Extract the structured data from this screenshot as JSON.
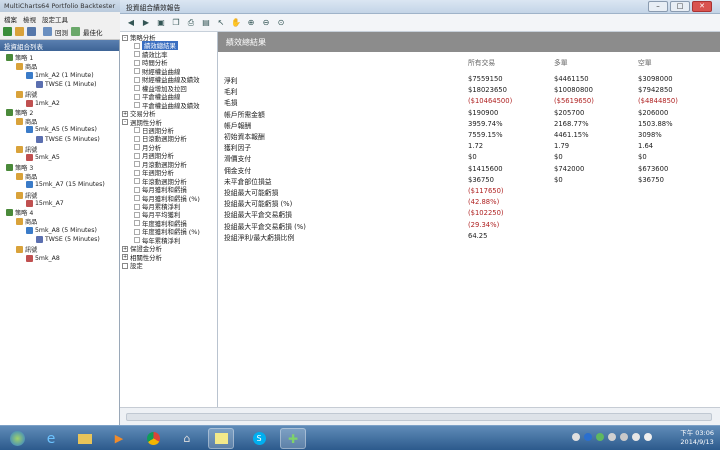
{
  "app": {
    "title": "MultiCharts64 Portfolio Backtester",
    "menu": [
      "檔案",
      "檢視",
      "設定工具"
    ],
    "toolbar": {
      "left_btn": "回測",
      "right_btn": "最佳化"
    }
  },
  "left_panel": {
    "header": "投資組合列表",
    "nodes": [
      {
        "label": "策略 1",
        "type": "strategy"
      },
      {
        "label": "商品",
        "type": "folder"
      },
      {
        "label": "1mk_A2 (1 Minute)",
        "type": "instrument"
      },
      {
        "label": "TWSE (1 Minute)",
        "type": "data"
      },
      {
        "label": "訊號",
        "type": "folder"
      },
      {
        "label": "1mk_A2",
        "type": "signal"
      },
      {
        "label": "策略 2",
        "type": "strategy"
      },
      {
        "label": "商品",
        "type": "folder"
      },
      {
        "label": "5mk_A5 (5 Minutes)",
        "type": "instrument"
      },
      {
        "label": "TWSE (5 Minutes)",
        "type": "data"
      },
      {
        "label": "訊號",
        "type": "folder"
      },
      {
        "label": "5mk_A5",
        "type": "signal"
      },
      {
        "label": "策略 3",
        "type": "strategy"
      },
      {
        "label": "商品",
        "type": "folder"
      },
      {
        "label": "15mk_A7 (15 Minutes)",
        "type": "instrument"
      },
      {
        "label": "訊號",
        "type": "folder"
      },
      {
        "label": "15mk_A7",
        "type": "signal"
      },
      {
        "label": "策略 4",
        "type": "strategy"
      },
      {
        "label": "商品",
        "type": "folder"
      },
      {
        "label": "5mk_A8 (5 Minutes)",
        "type": "instrument"
      },
      {
        "label": "TWSE (5 Minutes)",
        "type": "data"
      },
      {
        "label": "訊號",
        "type": "folder"
      },
      {
        "label": "5mk_A8",
        "type": "signal"
      }
    ]
  },
  "window": {
    "title": "投資組合績效報告",
    "min": "–",
    "max": "□",
    "close": "✕"
  },
  "nav": {
    "items": [
      {
        "label": "策略分析",
        "level": 0,
        "box": "-"
      },
      {
        "label": "績效總結果",
        "level": 1,
        "selected": true
      },
      {
        "label": "績效比率",
        "level": 1
      },
      {
        "label": "時間分析",
        "level": 1
      },
      {
        "label": "財經權益曲線",
        "level": 1
      },
      {
        "label": "財經權益曲線及績效",
        "level": 1
      },
      {
        "label": "權益增加及拉回",
        "level": 1
      },
      {
        "label": "平倉權益曲線",
        "level": 1
      },
      {
        "label": "平倉權益曲線及績效",
        "level": 1
      },
      {
        "label": "交易分析",
        "level": 0,
        "box": "+"
      },
      {
        "label": "週期性分析",
        "level": 0,
        "box": "-"
      },
      {
        "label": "日週期分析",
        "level": 1
      },
      {
        "label": "日滾動週期分析",
        "level": 1
      },
      {
        "label": "月分析",
        "level": 1
      },
      {
        "label": "月週期分析",
        "level": 1
      },
      {
        "label": "月滾動週期分析",
        "level": 1
      },
      {
        "label": "年週期分析",
        "level": 1
      },
      {
        "label": "年滾動週期分析",
        "level": 1
      },
      {
        "label": "每月獲利和虧損",
        "level": 1
      },
      {
        "label": "每月獲利和虧損 (%)",
        "level": 1
      },
      {
        "label": "每月累積淨利",
        "level": 1
      },
      {
        "label": "每月平均獲利",
        "level": 1
      },
      {
        "label": "年度獲利和虧損",
        "level": 1
      },
      {
        "label": "年度獲利和虧損 (%)",
        "level": 1
      },
      {
        "label": "每年累積淨利",
        "level": 1
      },
      {
        "label": "保證金分析",
        "level": 0,
        "box": "+"
      },
      {
        "label": "相關性分析",
        "level": 0,
        "box": "+"
      },
      {
        "label": "設定",
        "level": 0,
        "box": ""
      }
    ]
  },
  "report": {
    "header": "績效總結果",
    "columns": [
      "所有交易",
      "多單",
      "空單"
    ],
    "rows": [
      {
        "label": "淨利",
        "values": [
          "$7559150",
          "$4461150",
          "$3098000"
        ],
        "neg": [
          false,
          false,
          false
        ]
      },
      {
        "label": "毛利",
        "values": [
          "$18023650",
          "$10080800",
          "$7942850"
        ],
        "neg": [
          false,
          false,
          false
        ]
      },
      {
        "label": "毛損",
        "values": [
          "($10464500)",
          "($5619650)",
          "($4844850)"
        ],
        "neg": [
          true,
          true,
          true
        ]
      },
      {
        "label": "帳戶所需金額",
        "values": [
          "$190900",
          "$205700",
          "$206000"
        ],
        "neg": [
          false,
          false,
          false
        ]
      },
      {
        "label": "帳戶報酬",
        "values": [
          "3959.74%",
          "2168.77%",
          "1503.88%"
        ],
        "neg": [
          false,
          false,
          false
        ]
      },
      {
        "label": "初始資本報酬",
        "values": [
          "7559.15%",
          "4461.15%",
          "3098%"
        ],
        "neg": [
          false,
          false,
          false
        ]
      },
      {
        "label": "獲利因子",
        "values": [
          "1.72",
          "1.79",
          "1.64"
        ],
        "neg": [
          false,
          false,
          false
        ]
      },
      {
        "label": "滑價支付",
        "values": [
          "$0",
          "$0",
          "$0"
        ],
        "neg": [
          false,
          false,
          false
        ]
      },
      {
        "label": "佣金支付",
        "values": [
          "$1415600",
          "$742000",
          "$673600"
        ],
        "neg": [
          false,
          false,
          false
        ]
      },
      {
        "label": "未平倉部位損益",
        "values": [
          "$36750",
          "$0",
          "$36750"
        ],
        "neg": [
          false,
          false,
          false
        ]
      },
      {
        "label": "投組最大可能虧損",
        "values": [
          "($117650)",
          "",
          ""
        ],
        "neg": [
          true,
          false,
          false
        ]
      },
      {
        "label": "投組最大可能虧損 (%)",
        "values": [
          "(42.88%)",
          "",
          ""
        ],
        "neg": [
          true,
          false,
          false
        ]
      },
      {
        "label": "投組最大平倉交易虧損",
        "values": [
          "($102250)",
          "",
          ""
        ],
        "neg": [
          true,
          false,
          false
        ]
      },
      {
        "label": "投組最大平倉交易虧損 (%)",
        "values": [
          "(29.34%)",
          "",
          ""
        ],
        "neg": [
          true,
          false,
          false
        ]
      },
      {
        "label": "投組淨利/最大虧損比例",
        "values": [
          "64.25",
          "",
          ""
        ],
        "neg": [
          false,
          false,
          false
        ]
      }
    ]
  },
  "taskbar": {
    "time": "下午 03:06",
    "date": "2014/9/13"
  },
  "colors": {
    "selected": "#3b6fc1",
    "negative": "#b02424",
    "header": "#8c8c8c"
  }
}
